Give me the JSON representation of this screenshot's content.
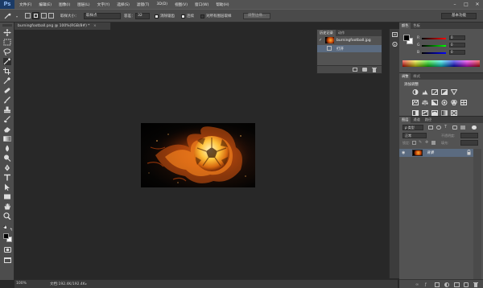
{
  "app": {
    "logo": "Ps"
  },
  "menu": [
    "文件(F)",
    "编辑(E)",
    "图像(I)",
    "图层(L)",
    "文字(Y)",
    "选择(S)",
    "滤镜(T)",
    "3D(D)",
    "视图(V)",
    "窗口(W)",
    "帮助(H)"
  ],
  "window_controls": [
    "–",
    "□",
    "✕"
  ],
  "options": {
    "feather_label": "取样大小：",
    "feather_value": "取样点",
    "tolerance_label": "容差：",
    "tolerance_value": "32",
    "antialias_label": "消除锯齿",
    "contiguous_label": "连续",
    "sample_all_label": "对所有图层取样",
    "refine_button": "调整边缘...",
    "workspace": "基本功能"
  },
  "document": {
    "tab_title": "burningfootball.png @ 100%(RGB/8#) *",
    "close": "×",
    "zoom": "100%",
    "doc_size": "文档:192.4K/192.4K"
  },
  "history": {
    "tabs": [
      "历史记录",
      "动作"
    ],
    "snapshot": "burningfootball.jpg",
    "state": "打开"
  },
  "color_panel": {
    "tabs": [
      "颜色",
      "色板"
    ],
    "channels": [
      {
        "label": "R",
        "value": "0"
      },
      {
        "label": "G",
        "value": "0"
      },
      {
        "label": "B",
        "value": "0"
      }
    ]
  },
  "adjustments": {
    "tabs": [
      "调整",
      "样式"
    ],
    "title": "添加调整"
  },
  "layers": {
    "tabs": [
      "图层",
      "通道",
      "路径"
    ],
    "kind_label": "ρ 类型",
    "blend_mode": "正常",
    "opacity_label": "不透明度:",
    "lock_label": "锁定:",
    "fill_label": "填充:",
    "layer_name": "背景"
  },
  "colors": {
    "menubar": "#535353",
    "accent": "#3e5f8a",
    "selected_row": "#5b6b80"
  }
}
